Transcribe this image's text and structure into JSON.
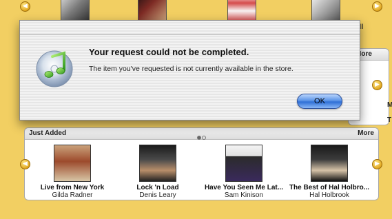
{
  "dialog": {
    "title": "Your request could not be completed.",
    "message": "The item you've requested is not currently available in the store.",
    "ok_label": "OK"
  },
  "background": {
    "top_right_fragment": "all",
    "right_panel_more": "More",
    "right_edge_letters": [
      "M",
      "T"
    ]
  },
  "just_added": {
    "title": "Just Added",
    "more_label": "More",
    "albums": [
      {
        "title": "Live from New York",
        "artist": "Gilda Radner"
      },
      {
        "title": "Lock 'n Load",
        "artist": "Denis Leary"
      },
      {
        "title": "Have You Seen Me Lat...",
        "artist": "Sam Kinison"
      },
      {
        "title": "The Best of Hal Holbro...",
        "artist": "Hal Holbrook"
      }
    ],
    "page_indicator": {
      "pages": 2,
      "current": 1
    }
  },
  "colors": {
    "store_background": "#f2cf62",
    "ok_button_accent": "#2f6fd6"
  },
  "icons": [
    "left-arrow-icon",
    "right-arrow-icon",
    "itunes-music-note-icon"
  ]
}
